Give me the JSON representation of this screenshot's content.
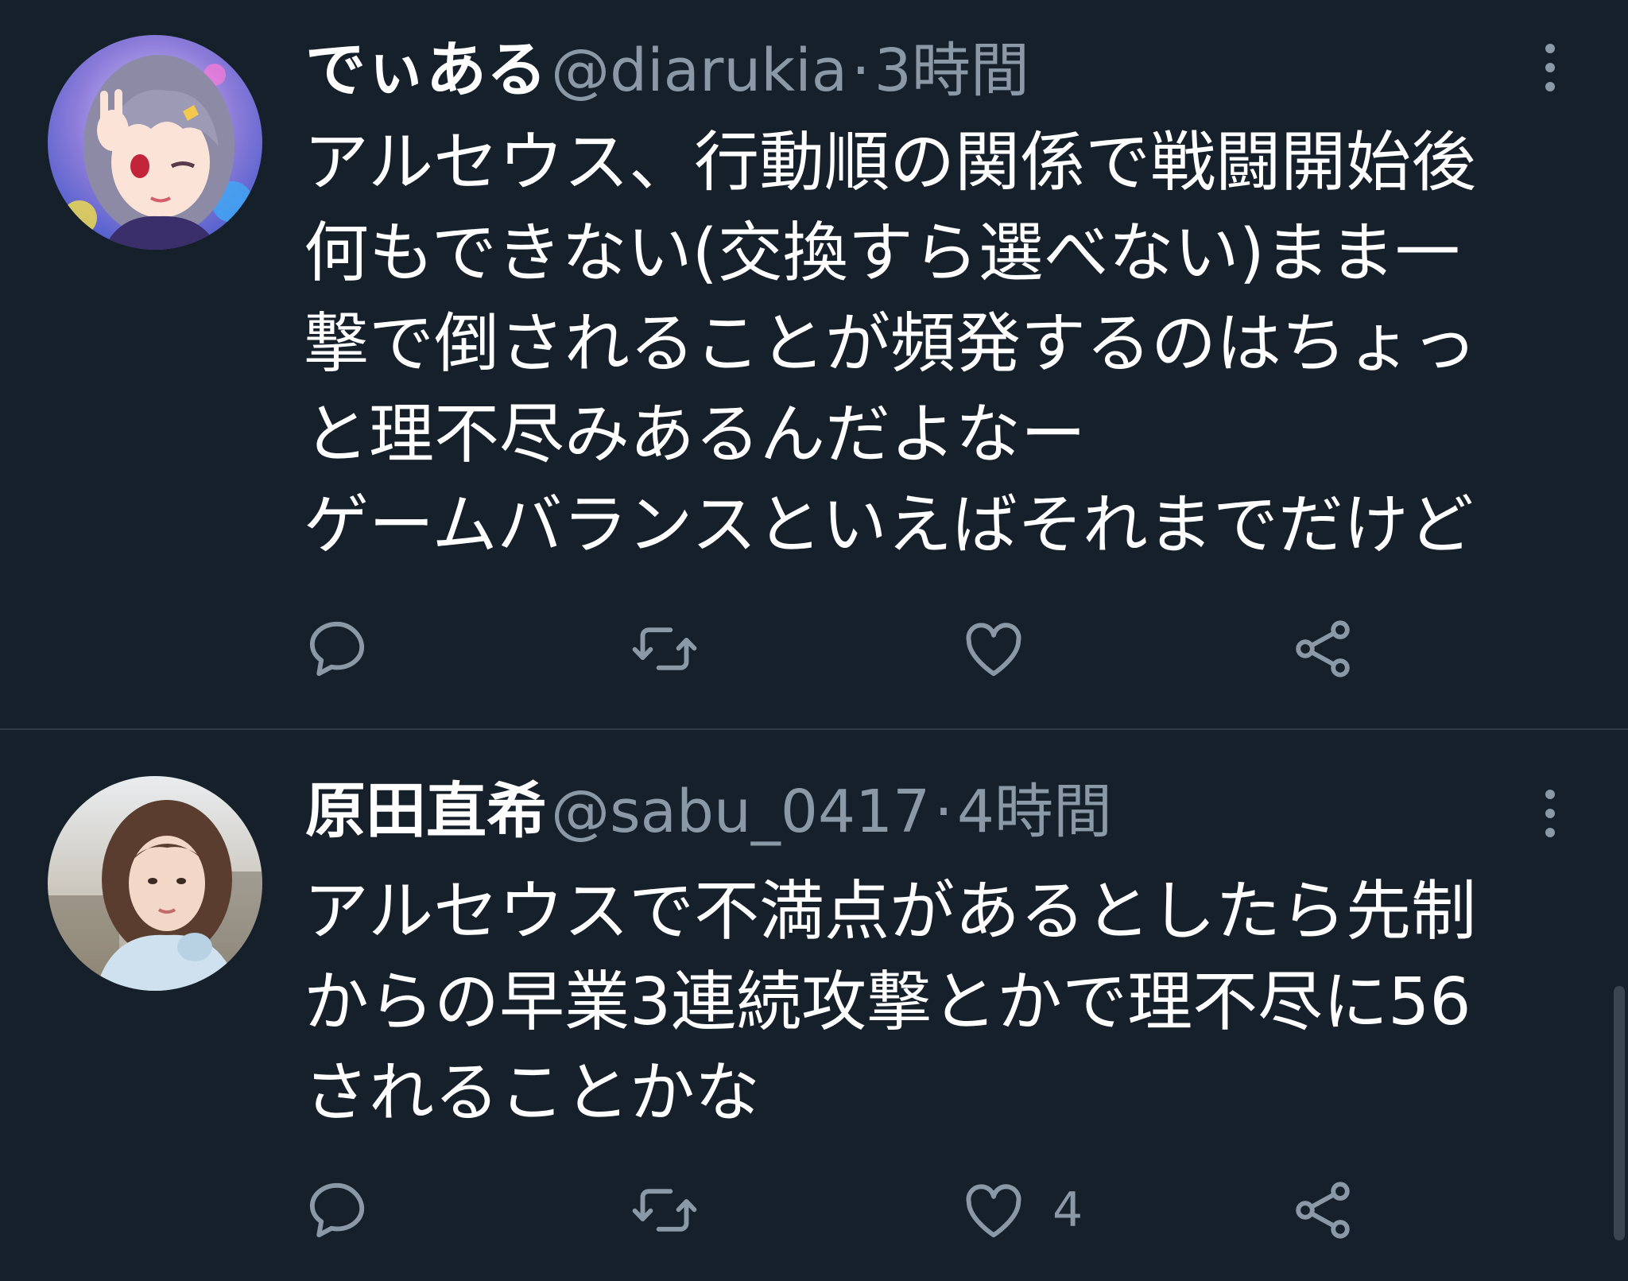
{
  "colors": {
    "background": "#15202b",
    "text_primary": "#ffffff",
    "text_secondary": "#8b98a5",
    "divider": "#2f3b48"
  },
  "tweets": [
    {
      "display_name": "でぃある",
      "handle": "@diarukia",
      "separator": "·",
      "time": "3時間",
      "avatar_icon": "anime-girl-avatar",
      "text_lines": [
        "アルセウス、行動順の関係で戦闘開始後",
        "何もできない(交換すら選べない)まま一",
        "撃で倒されることが頻発するのはちょっ",
        "と理不尽みあるんだよなー",
        "ゲームバランスといえばそれまでだけど"
      ],
      "actions": {
        "reply_icon": "reply-icon",
        "retweet_icon": "retweet-icon",
        "like_icon": "heart-icon",
        "like_count": "",
        "share_icon": "share-icon"
      }
    },
    {
      "display_name": "原田直希",
      "handle": "@sabu_0417",
      "separator": "·",
      "time": "4時間",
      "avatar_icon": "woman-photo-avatar",
      "text_lines": [
        "アルセウスで不満点があるとしたら先制",
        "からの早業3連続攻撃とかで理不尽に56",
        "されることかな"
      ],
      "actions": {
        "reply_icon": "reply-icon",
        "retweet_icon": "retweet-icon",
        "like_icon": "heart-icon",
        "like_count": "4",
        "share_icon": "share-icon"
      }
    }
  ]
}
